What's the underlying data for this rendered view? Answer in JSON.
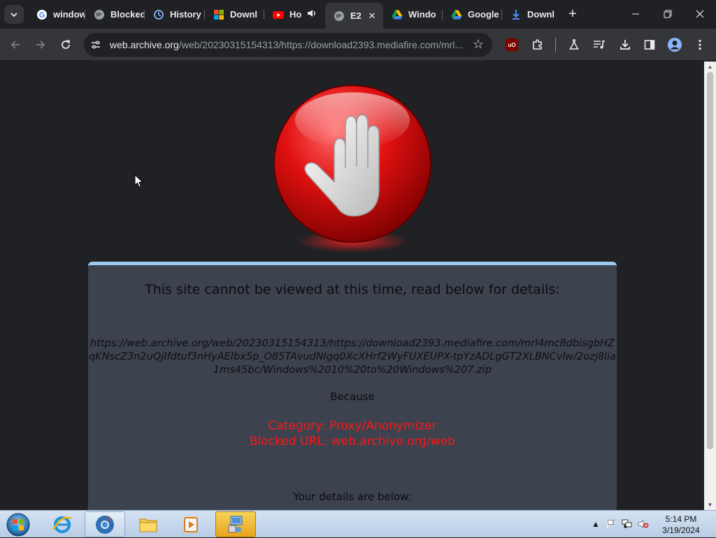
{
  "browser": {
    "tabs": [
      {
        "title": "window",
        "icon": "google-icon"
      },
      {
        "title": "Blocked",
        "icon": "globe-icon"
      },
      {
        "title": "History",
        "icon": "history-icon"
      },
      {
        "title": "Downl",
        "icon": "microsoft-icon"
      },
      {
        "title": "Ho",
        "icon": "youtube-icon"
      },
      {
        "title": "E2",
        "icon": "globe-icon"
      },
      {
        "title": "Windo",
        "icon": "google-drive-icon"
      },
      {
        "title": "Google",
        "icon": "google-drive-icon"
      },
      {
        "title": "Downl",
        "icon": "download-icon"
      }
    ],
    "active_tab_index": 5,
    "address": {
      "host": "web.archive.org",
      "path": "/web/20230315154313/https://download2393.mediafire.com/mrl..."
    }
  },
  "page": {
    "heading": "This site cannot be viewed at this time, read below for details:",
    "blocked_url": "https://web.archive.org/web/20230315154313/https://download2393.mediafire.com/mrl4mc8dbisgbHZqKNscZ3n2uQjIfdtuf3nHyAEIbx5p_O85TAvudNIgq0XcXHrf2WyFUXEUPX-tpYzADLgGT2XLBNCvlw/2ozj8lia1ms45bc/Windows%2010%20to%20Windows%207.zip",
    "because": "Because",
    "category": "Category: Proxy/Anonymizer",
    "blocked": "Blocked URL: web.archive.org/web",
    "details_heading": "Your details are below:"
  },
  "taskbar": {
    "time": "5:14 PM",
    "date": "3/19/2024"
  },
  "colors": {
    "accent": "#9ec9ef",
    "alert": "#ff1515",
    "card": "#3d424f",
    "stop_red": "#e01010"
  }
}
